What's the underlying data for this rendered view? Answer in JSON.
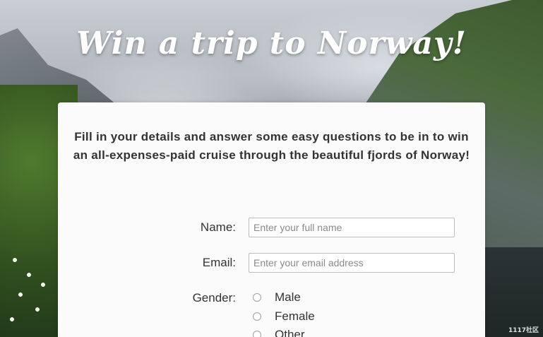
{
  "header": {
    "title": "Win a trip to Norway!"
  },
  "form": {
    "intro": "Fill in your details and answer some easy questions to be in to win an all-expenses-paid cruise through the beautiful fjords of Norway!",
    "name": {
      "label": "Name:",
      "placeholder": "Enter your full name",
      "value": ""
    },
    "email": {
      "label": "Email:",
      "placeholder": "Enter your email address",
      "value": ""
    },
    "gender": {
      "label": "Gender:",
      "options": [
        "Male",
        "Female",
        "Other"
      ]
    }
  },
  "watermark": "1117社区"
}
